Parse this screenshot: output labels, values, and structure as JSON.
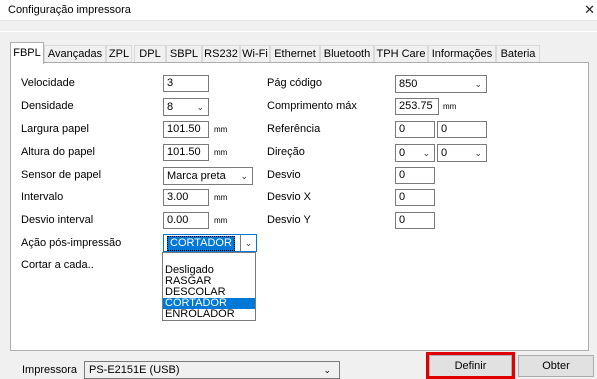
{
  "window": {
    "title": "Configuração impressora",
    "close_glyph": "✕"
  },
  "tabs": [
    {
      "label": "FBPL",
      "active": true
    },
    {
      "label": "Avançadas"
    },
    {
      "label": "ZPL"
    },
    {
      "label": "DPL"
    },
    {
      "label": "SBPL"
    },
    {
      "label": "RS232"
    },
    {
      "label": "Wi-Fi"
    },
    {
      "label": "Ethernet"
    },
    {
      "label": "Bluetooth"
    },
    {
      "label": "TPH Care"
    },
    {
      "label": "Informações"
    },
    {
      "label": "Bateria"
    }
  ],
  "left": {
    "velocidade": {
      "label": "Velocidade",
      "value": "3"
    },
    "densidade": {
      "label": "Densidade",
      "value": "8"
    },
    "largura": {
      "label": "Largura papel",
      "value": "101.50",
      "unit": "mm"
    },
    "altura": {
      "label": "Altura do papel",
      "value": "101.50",
      "unit": "mm"
    },
    "sensor": {
      "label": "Sensor de papel",
      "value": "Marca preta"
    },
    "intervalo": {
      "label": "Intervalo",
      "value": "3.00",
      "unit": "mm"
    },
    "desvio_interval": {
      "label": "Desvio interval",
      "value": "0.00",
      "unit": "mm"
    },
    "acao": {
      "label": "Ação pós-impressão",
      "value": "CORTADOR"
    },
    "cortar": {
      "label": "Cortar a cada.."
    }
  },
  "right": {
    "pag_codigo": {
      "label": "Pág código",
      "value": "850"
    },
    "comprimento": {
      "label": "Comprimento máx",
      "value": "253.75",
      "unit": "mm"
    },
    "referencia": {
      "label": "Referência",
      "value1": "0",
      "value2": "0"
    },
    "direcao": {
      "label": "Direção",
      "value1": "0",
      "value2": "0"
    },
    "desvio": {
      "label": "Desvio",
      "value": "0"
    },
    "desvio_x": {
      "label": "Desvio X",
      "value": "0"
    },
    "desvio_y": {
      "label": "Desvio Y",
      "value": "0"
    }
  },
  "dropdown_options": [
    "Desligado",
    "RASGAR",
    "DESCOLAR",
    "CORTADOR",
    "ENROLADOR"
  ],
  "dropdown_highlighted": "CORTADOR",
  "footer": {
    "printer_label": "Impressora",
    "printer_value": "PS-E2151E (USB)",
    "definir_label": "Definir",
    "obter_label": "Obter"
  },
  "icons": {
    "dropdown_arrow": "chevron-down-icon"
  },
  "colors": {
    "selection": "#0078d7",
    "annotation_box": "#e00000"
  }
}
